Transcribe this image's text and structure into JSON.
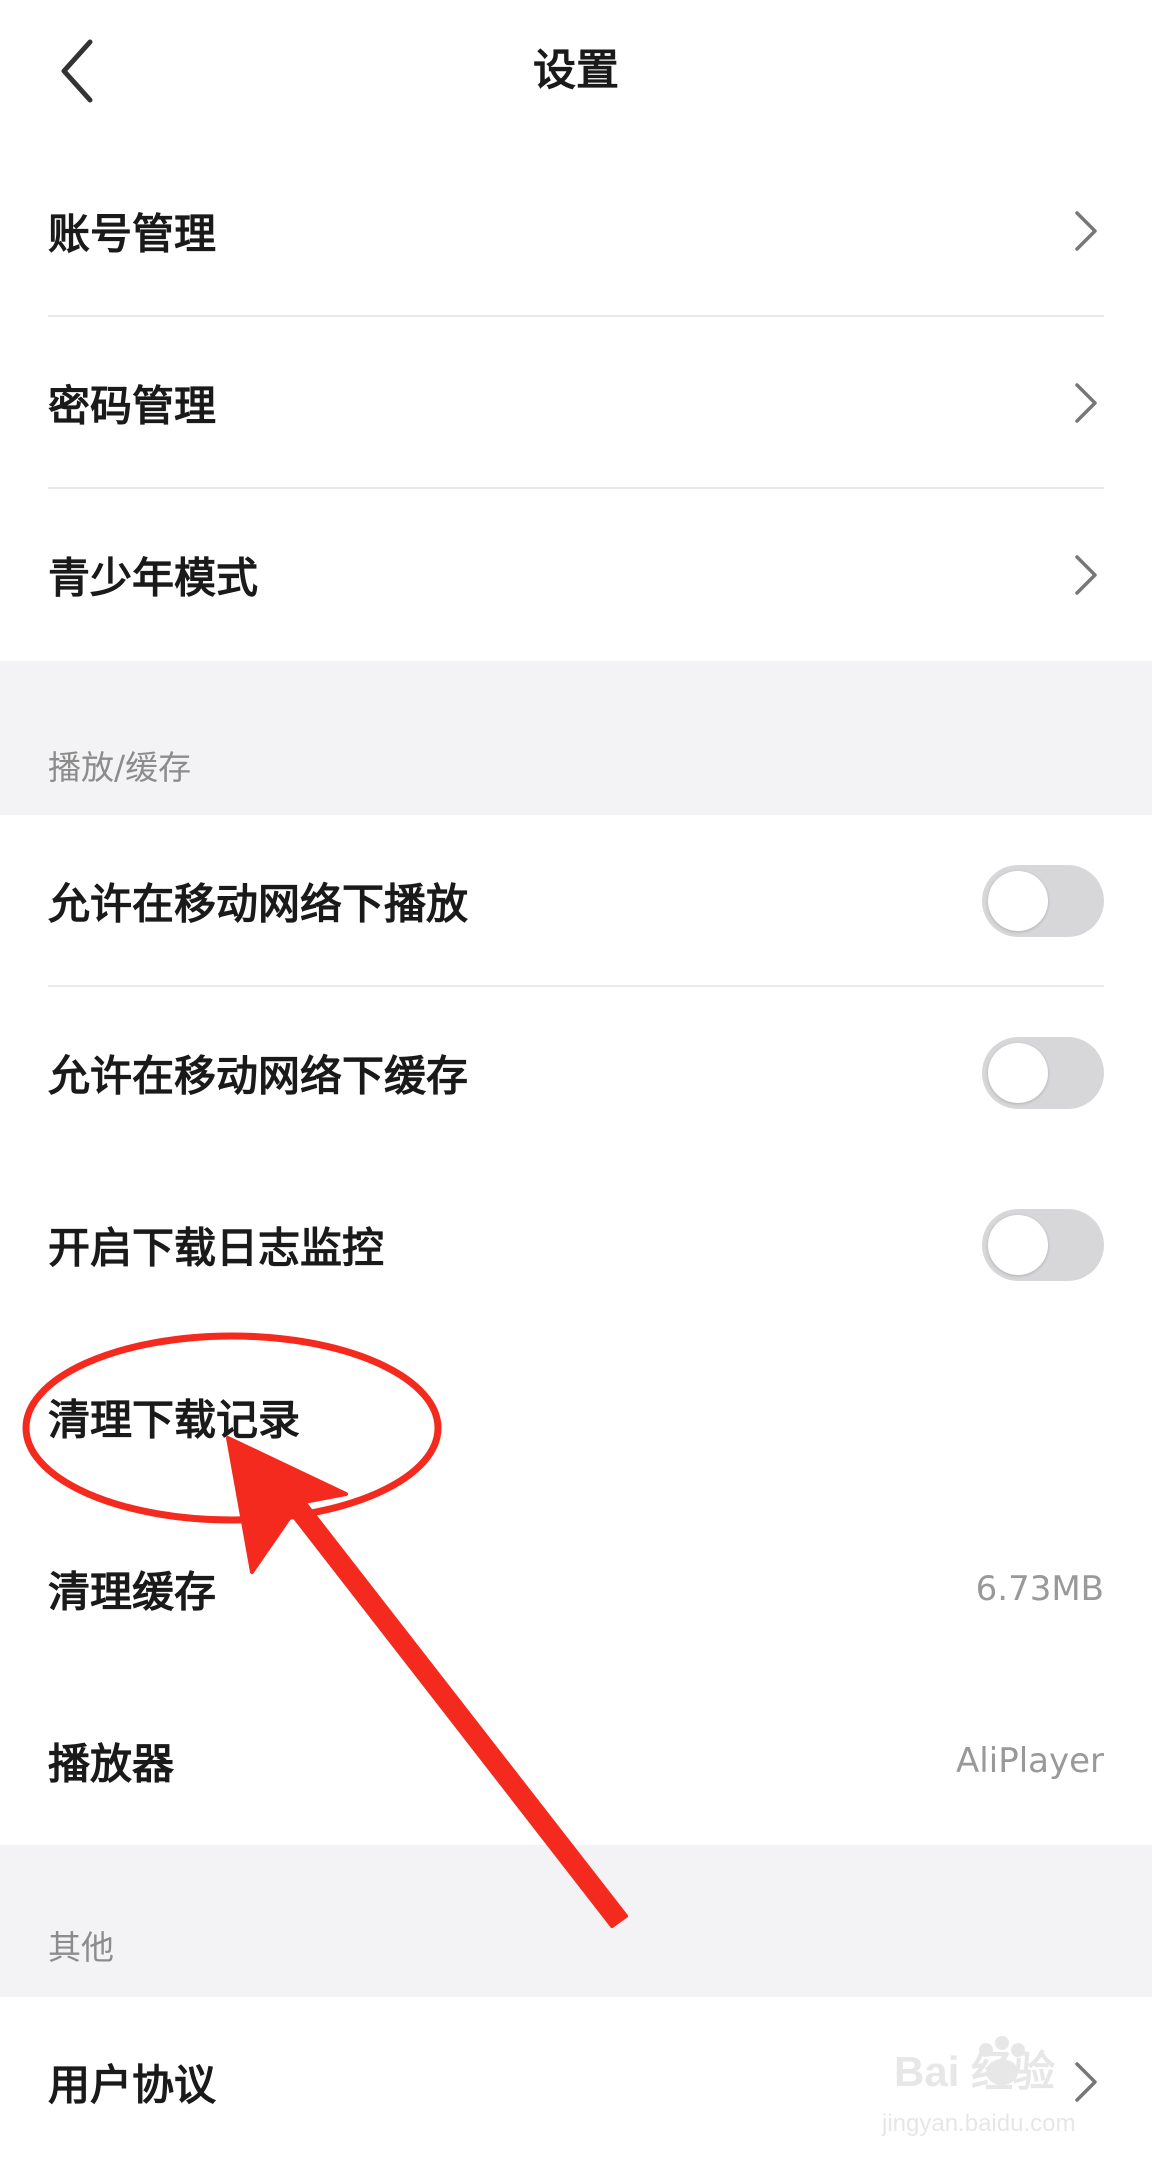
{
  "header": {
    "title": "设置"
  },
  "account": {
    "items": [
      {
        "label": "账号管理"
      },
      {
        "label": "密码管理"
      },
      {
        "label": "青少年模式"
      }
    ]
  },
  "playback": {
    "section_title": "播放/缓存",
    "allow_mobile_play": {
      "label": "允许在移动网络下播放",
      "on": false
    },
    "allow_mobile_cache": {
      "label": "允许在移动网络下缓存",
      "on": false
    },
    "download_log_monitor": {
      "label": "开启下载日志监控",
      "on": false
    },
    "clear_download_records": {
      "label": "清理下载记录"
    },
    "clear_cache": {
      "label": "清理缓存",
      "value": "6.73MB"
    },
    "player": {
      "label": "播放器",
      "value": "AliPlayer"
    }
  },
  "other": {
    "section_title": "其他",
    "items": [
      {
        "label": "用户协议"
      }
    ]
  },
  "watermark": {
    "brand": "Bai  经验",
    "url": "jingyan.baidu.com"
  },
  "colors": {
    "annotation": "#f42a1f",
    "toggle_off": "#d7d7d9",
    "section_bg": "#f3f3f5"
  }
}
